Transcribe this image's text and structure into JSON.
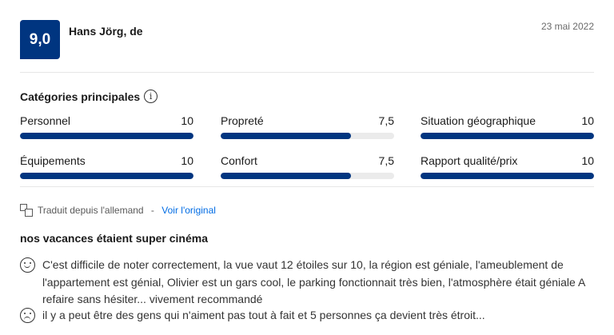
{
  "review": {
    "score": "9,0",
    "reviewer": "Hans Jörg, de",
    "date": "23 mai 2022"
  },
  "categories": {
    "title": "Catégories principales",
    "items": [
      {
        "label": "Personnel",
        "value": "10",
        "fill": 1.0
      },
      {
        "label": "Propreté",
        "value": "7,5",
        "fill": 0.75
      },
      {
        "label": "Situation géographique",
        "value": "10",
        "fill": 1.0
      },
      {
        "label": "Équipements",
        "value": "10",
        "fill": 1.0
      },
      {
        "label": "Confort",
        "value": "7,5",
        "fill": 0.75
      },
      {
        "label": "Rapport qualité/prix",
        "value": "10",
        "fill": 1.0
      }
    ],
    "bar_color": "#003580"
  },
  "translation": {
    "note": "Traduit depuis l'allemand",
    "separator": " - ",
    "link": "Voir l'original"
  },
  "body": {
    "title": "nos vacances étaient super cinéma",
    "positive_icon": "smiley-happy-icon",
    "positive": "C'est difficile de noter correctement, la vue vaut 12 étoiles sur 10, la région est géniale, l'ameublement de l'appartement est génial, Olivier est un gars cool, le parking fonctionnait très bien, l'atmosphère était géniale A refaire sans hésiter... vivement recommandé",
    "negative_icon": "smiley-sad-icon",
    "negative": "il y a peut être des gens qui n'aiment pas tout à fait et 5 personnes ça devient très étroit..."
  }
}
